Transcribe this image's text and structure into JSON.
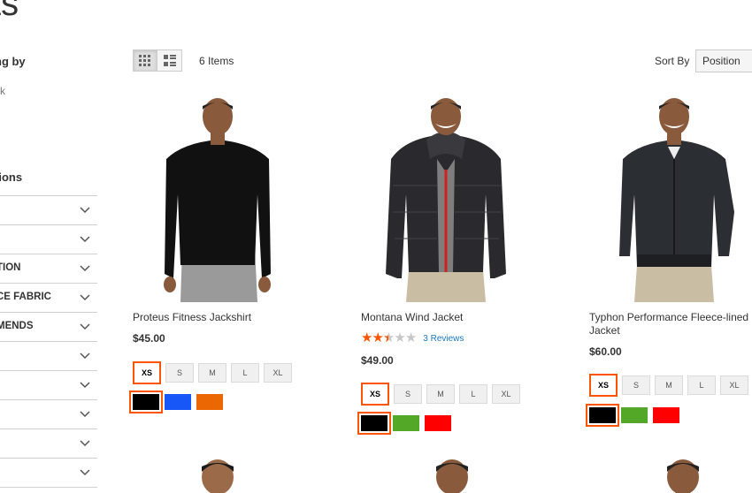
{
  "page": {
    "title": "ts"
  },
  "sidebar": {
    "shopping_by": "ng by",
    "current_item": "ck",
    "options_title": "tions",
    "filters": [
      {
        "label": ""
      },
      {
        "label": ""
      },
      {
        "label": "TION"
      },
      {
        "label": "CE FABRIC"
      },
      {
        "label": "MENDS"
      },
      {
        "label": ""
      },
      {
        "label": ""
      },
      {
        "label": ""
      },
      {
        "label": ""
      },
      {
        "label": ""
      }
    ]
  },
  "toolbar": {
    "grid_mode_icon": "grid-icon",
    "list_mode_icon": "list-icon",
    "items_count": "6 Items",
    "sort_label": "Sort By",
    "sort_selected": "Position"
  },
  "products": [
    {
      "name": "Proteus Fitness Jackshirt",
      "price": "$45.00",
      "sizes": [
        "XS",
        "S",
        "M",
        "L",
        "XL"
      ],
      "selected_size": "XS",
      "colors": [
        "#000000",
        "#1857f7",
        "#eb6703"
      ],
      "selected_color": 0,
      "rating_percent": null
    },
    {
      "name": "Montana Wind Jacket",
      "price": "$49.00",
      "reviews": "3  Reviews",
      "rating_percent": 50,
      "sizes": [
        "XS",
        "S",
        "M",
        "L",
        "XL"
      ],
      "selected_size": "XS",
      "colors": [
        "#000000",
        "#53a828",
        "#ff0000"
      ],
      "selected_color": 0
    },
    {
      "name": "Typhon Performance Fleece-lined Jacket",
      "price": "$60.00",
      "sizes": [
        "XS",
        "S",
        "M",
        "L",
        "XL"
      ],
      "selected_size": "XS",
      "colors": [
        "#000000",
        "#53a828",
        "#ff0000"
      ],
      "selected_color": 0,
      "rating_percent": null
    }
  ]
}
